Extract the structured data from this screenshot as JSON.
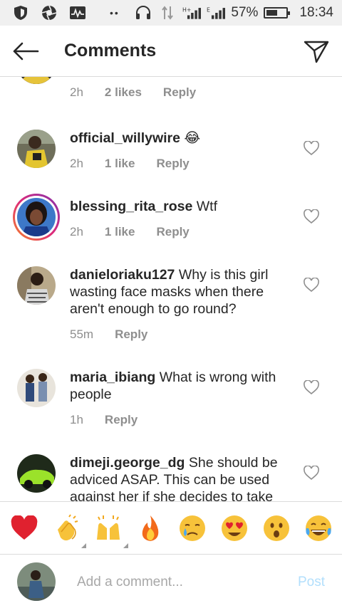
{
  "status_bar": {
    "icons": [
      "shield-icon",
      "aperture-icon",
      "activity-icon"
    ],
    "dots": "••",
    "right_icons": [
      "headphones-icon",
      "data-arrows-icon",
      "signal-icon-hd",
      "signal-icon-e"
    ],
    "battery_percent": "57%",
    "battery_level": 0.57,
    "time": "18:34"
  },
  "header": {
    "title": "Comments",
    "back_icon": "arrow-left-icon",
    "send_icon": "paper-plane-icon"
  },
  "comments": [
    {
      "username": "",
      "text": "",
      "time": "2h",
      "likes": "2 likes",
      "reply": "Reply"
    },
    {
      "username": "official_willywire",
      "text": "😂",
      "time": "2h",
      "likes": "1 like",
      "reply": "Reply"
    },
    {
      "username": "blessing_rita_rose",
      "text": "Wtf",
      "time": "2h",
      "likes": "1 like",
      "reply": "Reply"
    },
    {
      "username": "danieloriaku127",
      "text": "Why is this girl wasting face masks when there aren't enough to go round?",
      "time": "55m",
      "reply": "Reply"
    },
    {
      "username": "maria_ibiang",
      "text": "What is wrong with people",
      "time": "1h",
      "reply": "Reply"
    },
    {
      "username": "dimeji.george_dg",
      "text": "She should be adviced ASAP.  This can be used against her if she decides to take"
    }
  ],
  "emoji_bar": {
    "emojis": [
      "❤️",
      "👏",
      "🙌",
      "🔥",
      "😢",
      "😍",
      "😮",
      "😂"
    ]
  },
  "composer": {
    "placeholder": "Add a comment...",
    "post_label": "Post"
  },
  "colors": {
    "text": "#262626",
    "meta": "#8e8e8e",
    "post_disabled": "#b2dffc",
    "story_ring_start": "#f58529",
    "story_ring_end": "#dd2a7b"
  }
}
